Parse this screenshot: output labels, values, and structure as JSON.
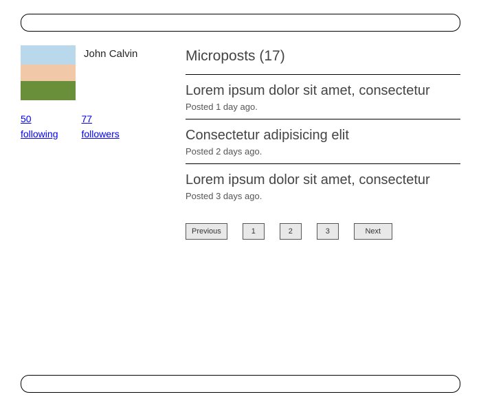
{
  "user": {
    "name": "John Calvin",
    "following_count": "50",
    "following_label": "following",
    "followers_count": "77",
    "followers_label": "followers"
  },
  "microposts": {
    "title_prefix": "Microposts",
    "count": "17",
    "items": [
      {
        "text": "Lorem ipsum dolor sit amet, consectetur",
        "meta": "Posted 1 day ago."
      },
      {
        "text": "Consectetur adipisicing elit",
        "meta": "Posted 2 days ago."
      },
      {
        "text": "Lorem ipsum dolor sit amet, consectetur",
        "meta": "Posted 3 days ago."
      }
    ]
  },
  "pagination": {
    "prev": "Previous",
    "pages": [
      "1",
      "2",
      "3"
    ],
    "next": "Next"
  }
}
